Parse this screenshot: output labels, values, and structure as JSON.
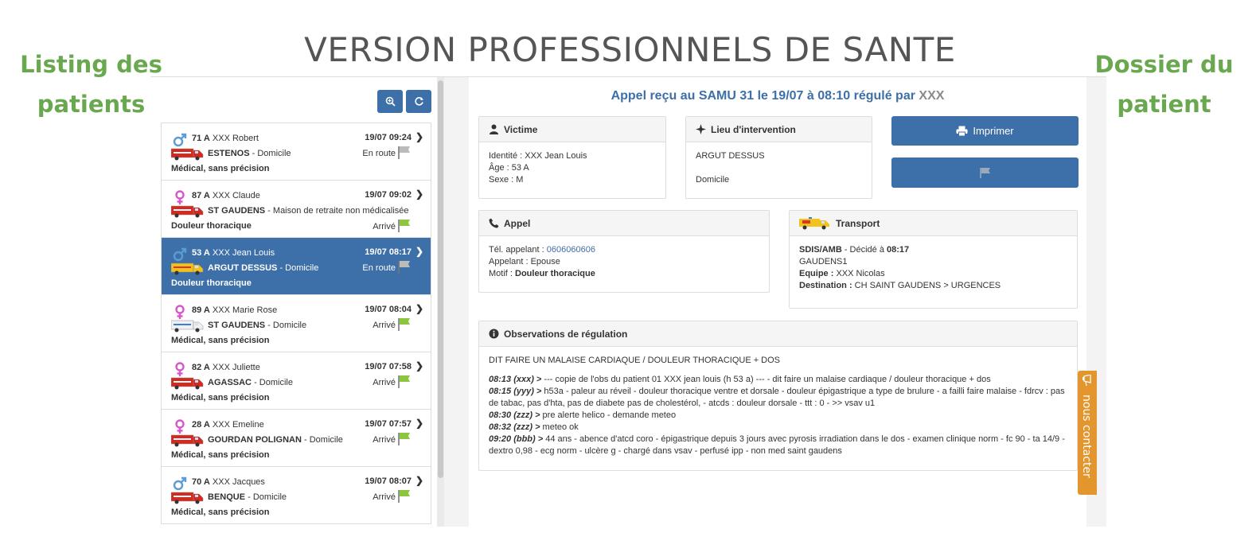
{
  "page": {
    "main_title": "VERSION PROFESSIONNELS DE SANTE",
    "left_label_1": "Listing des",
    "left_label_2": "patients",
    "right_label_1": "Dossier du",
    "right_label_2": "patient"
  },
  "colors": {
    "primary": "#3d6fa8",
    "label_green": "#6aa84f",
    "contact_orange": "#e3962d",
    "male": "#5b9bd5",
    "female": "#d957c8",
    "flag_green": "#8cc63f",
    "flag_gray": "#bbbbbb"
  },
  "toolbar": {
    "zoom_icon": "search-plus-icon",
    "refresh_icon": "refresh-icon"
  },
  "patients": [
    {
      "gender": "male",
      "age": "71 A",
      "name": "XXX Robert",
      "time": "19/07 09:24",
      "city": "ESTENOS",
      "place": " - Domicile",
      "status": "En route",
      "flag": "gray",
      "reason": "Médical, sans précision",
      "vehicle": "ambulance-red"
    },
    {
      "gender": "female",
      "age": "87 A",
      "name": "XXX Claude",
      "time": "19/07 09:02",
      "city": "ST GAUDENS",
      "place": " - Maison de retraite non médicalisée",
      "status": "Arrivé",
      "flag": "green",
      "reason": "Douleur thoracique",
      "vehicle": "ambulance-red"
    },
    {
      "gender": "male",
      "age": "53 A",
      "name": "XXX Jean Louis",
      "time": "19/07 08:17",
      "city": "ARGUT DESSUS",
      "place": " - Domicile",
      "status": "En route",
      "flag": "gray",
      "reason": "Douleur thoracique",
      "vehicle": "ambulance-yellow"
    },
    {
      "gender": "female",
      "age": "89 A",
      "name": "XXX Marie Rose",
      "time": "19/07 08:04",
      "city": "ST GAUDENS",
      "place": " - Domicile",
      "status": "Arrivé",
      "flag": "green",
      "reason": "Médical, sans précision",
      "vehicle": "ambulance-white"
    },
    {
      "gender": "female",
      "age": "82 A",
      "name": "XXX Juliette",
      "time": "19/07 07:58",
      "city": "AGASSAC",
      "place": " - Domicile",
      "status": "Arrivé",
      "flag": "green",
      "reason": "Médical, sans précision",
      "vehicle": "ambulance-red"
    },
    {
      "gender": "female",
      "age": "28 A",
      "name": "XXX Emeline",
      "time": "19/07 07:57",
      "city": "GOURDAN POLIGNAN",
      "place": " - Domicile",
      "status": "Arrivé",
      "flag": "green",
      "reason": "Médical, sans précision",
      "vehicle": "ambulance-red"
    },
    {
      "gender": "male",
      "age": "70 A",
      "name": "XXX Jacques",
      "time": "19/07 08:07",
      "city": "BENQUE",
      "place": " - Domicile",
      "status": "Arrivé",
      "flag": "green",
      "reason": "Médical, sans précision",
      "vehicle": "ambulance-red"
    }
  ],
  "dossier": {
    "header_main": "Appel reçu au SAMU 31 le 19/07 à 08:10 régulé par ",
    "header_operator": "XXX",
    "victime": {
      "title": "Victime",
      "identity": "Identité : XXX Jean Louis",
      "age": "Âge : 53 A",
      "sex": "Sexe : M"
    },
    "lieu": {
      "title": "Lieu d'intervention",
      "place": "ARGUT DESSUS",
      "type": "Domicile"
    },
    "print_label": "Imprimer",
    "appel": {
      "title": "Appel",
      "tel_label": "Tél. appelant : ",
      "tel_value": "0606060606",
      "caller": "Appelant : Epouse",
      "motif_label": "Motif : ",
      "motif_value": "Douleur thoracique"
    },
    "transport": {
      "title": "Transport",
      "type_label": "SDIS/AMB",
      "decided": " - Décidé à ",
      "decided_time": "08:17",
      "unit": "GAUDENS1",
      "team_label": "Equipe : ",
      "team_value": "XXX Nicolas",
      "dest_label": "Destination : ",
      "dest_value": "CH SAINT GAUDENS > URGENCES"
    },
    "observations": {
      "title": "Observations de régulation",
      "summary": "DIT FAIRE UN MALAISE CARDIAQUE / DOULEUR THORACIQUE + DOS",
      "entries": [
        {
          "time": "08:13 (xxx) >",
          "text": " --- copie de l'obs du patient 01 XXX jean louis (h 53 a) --- - dit faire un malaise cardiaque / douleur thoracique + dos"
        },
        {
          "time": "08:15 (yyy) >",
          "text": " h53a - paleur au réveil - douleur thoracique ventre et dorsale - douleur épigastrique a type de brulure - a failli faire malaise - fdrcv : pas de tabac, pas d'hta, pas de diabete pas de cholestérol, - atcds : douleur dorsale - ttt : 0 - >> vsav u1"
        },
        {
          "time": "08:30 (zzz) >",
          "text": " pre alerte helico - demande meteo"
        },
        {
          "time": "08:32 (zzz) >",
          "text": " meteo ok"
        },
        {
          "time": "09:20 (bbb) >",
          "text": " 44 ans - abence d'atcd coro - épigastrique depuis 3 jours avec pyrosis irradiation dans le dos - examen clinique norm - fc 90 - ta 14/9 - dextro 0,98 - ecg norm - ulcère g - chargé dans vsav - perfusé ipp - non med saint gaudens"
        }
      ]
    }
  },
  "contact_tab": "nous contacter"
}
